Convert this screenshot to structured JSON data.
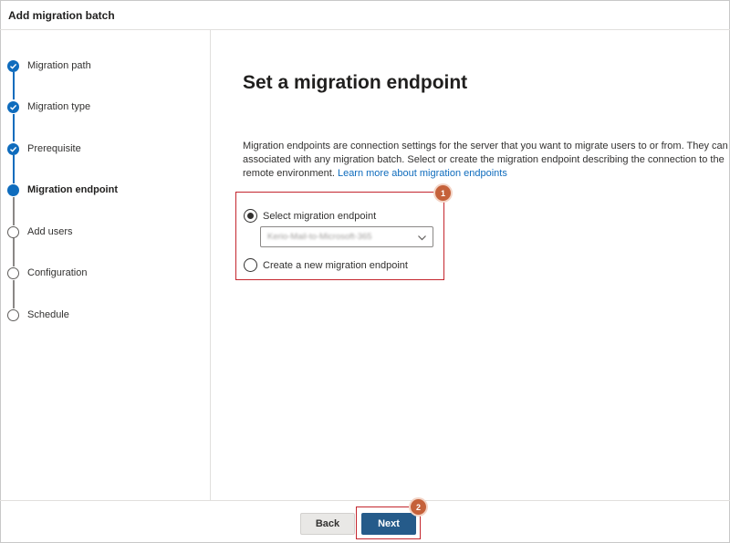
{
  "window": {
    "title": "Add migration batch"
  },
  "steps": [
    {
      "label": "Migration path",
      "state": "done"
    },
    {
      "label": "Migration type",
      "state": "done"
    },
    {
      "label": "Prerequisite",
      "state": "done"
    },
    {
      "label": "Migration endpoint",
      "state": "current"
    },
    {
      "label": "Add users",
      "state": "todo"
    },
    {
      "label": "Configuration",
      "state": "todo"
    },
    {
      "label": "Schedule",
      "state": "todo"
    }
  ],
  "main": {
    "title": "Set a migration endpoint",
    "description_line1": "Migration endpoints are connection settings for the server that you want to migrate users to or from. They can be",
    "description_line2": "associated with any migration batch. Select or create the migration endpoint describing the connection to the",
    "description_line3_prefix": "remote environment.",
    "description_link": "Learn more about migration endpoints",
    "options": {
      "select_existing_label": "Select migration endpoint",
      "select_existing_checked": true,
      "endpoint_value": "Kerio-Mail-to-Microsoft-365",
      "create_new_label": "Create a new migration endpoint",
      "create_new_checked": false
    }
  },
  "callouts": {
    "first": "1",
    "second": "2"
  },
  "footer": {
    "back_label": "Back",
    "next_label": "Next"
  },
  "colors": {
    "accent": "#0f6cbd",
    "primary_button": "#255b8a",
    "callout_border": "#c4262e",
    "callout_badge": "#c5613a"
  },
  "icons": {
    "step_done": "checkmark-circle-icon",
    "step_current": "filled-circle-icon",
    "step_todo": "empty-circle-icon",
    "dropdown": "chevron-down-icon"
  }
}
